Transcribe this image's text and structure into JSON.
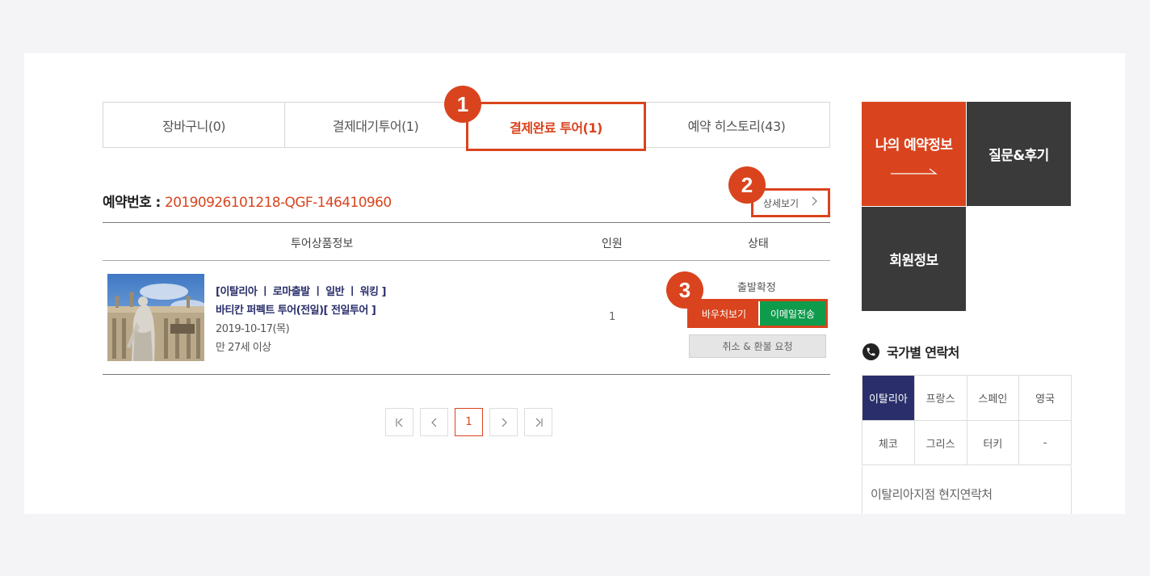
{
  "tabs": [
    {
      "label": "장바구니(0)"
    },
    {
      "label": "결제대기투어(1)"
    },
    {
      "label": "결제완료 투어(1)"
    },
    {
      "label": "예약 히스토리(43)"
    }
  ],
  "badges": {
    "one": "1",
    "two": "2",
    "three": "3"
  },
  "reservation": {
    "label": "예약번호 : ",
    "number": "20190926101218-QGF-146410960"
  },
  "detail_button": {
    "label": "상세보기",
    "icon": "chevron-right-icon"
  },
  "table": {
    "headers": [
      "투어상품정보",
      "인원",
      "상태"
    ],
    "row": {
      "tags": "[이탈리아 ㅣ 로마출발 ㅣ 일반 ㅣ 워킹 ]",
      "name": "바티칸 퍼펙트 투어(전일)[ 전일투어 ]",
      "date": "2019-10-17(목)",
      "age": "만 27세 이상",
      "quantity": "1",
      "status": "출발확정",
      "voucher_label": "바우처보기",
      "email_label": "이메일전송",
      "cancel_label": "취소 & 환불 요청"
    }
  },
  "pagination": {
    "current": "1",
    "first": "first-page-icon",
    "prev": "prev-page-icon",
    "next": "next-page-icon",
    "last": "last-page-icon"
  },
  "side_menu": {
    "reservation_info": "나의 예약정보",
    "qna_review": "질문&후기",
    "member_info": "회원정보"
  },
  "contact": {
    "title": "국가별 연락처",
    "countries_row1": [
      "이탈리아",
      "프랑스",
      "스페인",
      "영국"
    ],
    "countries_row2": [
      "체코",
      "그리스",
      "터키",
      "-"
    ],
    "selected": "이탈리아",
    "local_label": "이탈리아지점 현지연락처"
  },
  "colors": {
    "accent": "#d9441e",
    "navy": "#2a2f6b",
    "green": "#0e9b4c",
    "dark": "#3a3a3a"
  }
}
